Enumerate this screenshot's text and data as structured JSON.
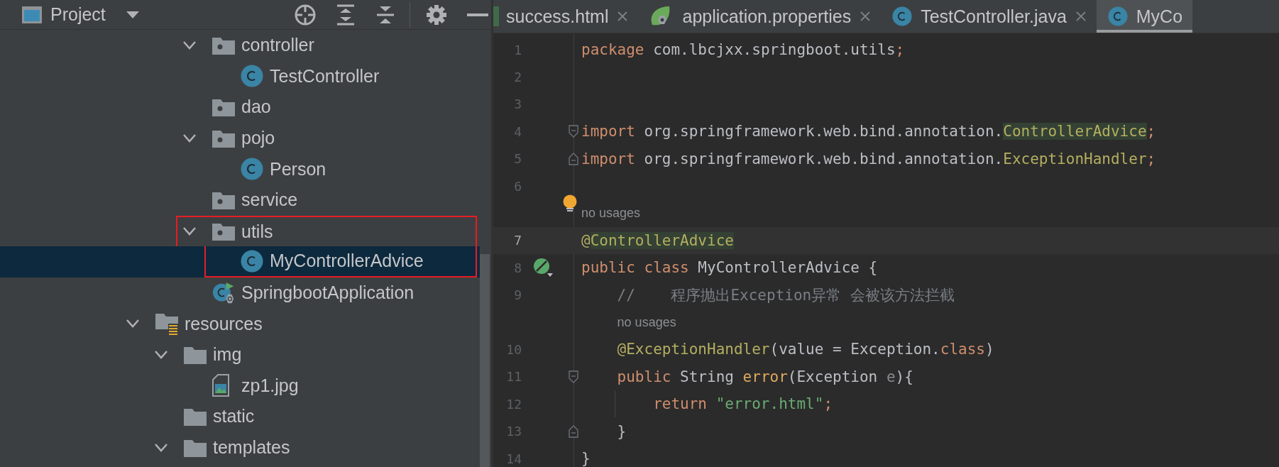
{
  "project_panel": {
    "title": "Project",
    "tree": [
      {
        "children": [
          {
            "children": [
              {
                "label": "controller",
                "kind": "package",
                "expanded": true,
                "selected": false,
                "annotated": false,
                "children": [
                  {
                    "label": "TestController",
                    "kind": "class",
                    "selected": false,
                    "annotated": false
                  }
                ]
              },
              {
                "label": "dao",
                "kind": "package",
                "selected": false,
                "annotated": false
              },
              {
                "label": "pojo",
                "kind": "package",
                "expanded": true,
                "selected": false,
                "annotated": false,
                "children": [
                  {
                    "label": "Person",
                    "kind": "class",
                    "selected": false,
                    "annotated": false
                  }
                ]
              },
              {
                "label": "service",
                "kind": "package",
                "selected": false,
                "annotated": false
              },
              {
                "label": "utils",
                "kind": "package",
                "expanded": true,
                "selected": false,
                "annotated": true,
                "children": [
                  {
                    "label": "MyControllerAdvice",
                    "kind": "class",
                    "selected": true,
                    "annotated": true
                  }
                ]
              },
              {
                "label": "SpringbootApplication",
                "kind": "spring_app",
                "selected": false,
                "annotated": false
              }
            ]
          }
        ]
      },
      {
        "label": "resources",
        "kind": "resources",
        "expanded": true,
        "selected": false,
        "annotated": false,
        "children": [
          {
            "label": "img",
            "kind": "folder",
            "expanded": true,
            "selected": false,
            "annotated": false,
            "children": [
              {
                "label": "zp1.jpg",
                "kind": "image_file",
                "selected": false,
                "annotated": false
              }
            ]
          },
          {
            "label": "static",
            "kind": "folder",
            "selected": false,
            "annotated": false
          },
          {
            "label": "templates",
            "kind": "folder",
            "expanded": true,
            "selected": false,
            "annotated": false
          }
        ]
      }
    ]
  },
  "editor": {
    "tabs": [
      {
        "label": "success.html",
        "kind": "partial",
        "closable": true,
        "selected": false
      },
      {
        "label": "application.properties",
        "kind": "spring",
        "closable": true,
        "selected": false
      },
      {
        "label": "TestController.java",
        "kind": "class",
        "closable": true,
        "selected": false
      },
      {
        "label": "MyCo",
        "kind": "class",
        "closable": false,
        "selected": true
      }
    ],
    "lines": [
      {
        "kind": "code",
        "number": "1",
        "current": false,
        "tokens": [
          {
            "text": "package",
            "kind": "keyword"
          },
          {
            "text": " com.lbcjxx.springboot.utils",
            "kind": "text"
          },
          {
            "text": ";",
            "kind": "keyword"
          }
        ]
      },
      {
        "kind": "code",
        "number": "2",
        "current": false
      },
      {
        "kind": "code",
        "number": "3",
        "current": false
      },
      {
        "kind": "code",
        "number": "4",
        "current": false,
        "marker": {
          "kind": "fold_start"
        },
        "tokens": [
          {
            "text": "import",
            "kind": "keyword"
          },
          {
            "text": " org.springframework.web.bind.annotation.",
            "kind": "text"
          },
          {
            "text": "ControllerAdvice",
            "kind": "annotation",
            "usage_highlight": true
          },
          {
            "text": ";",
            "kind": "keyword"
          }
        ]
      },
      {
        "kind": "code",
        "number": "5",
        "current": false,
        "marker": {
          "kind": "fold_end"
        },
        "tokens": [
          {
            "text": "import",
            "kind": "keyword"
          },
          {
            "text": " org.springframework.web.bind.annotation.",
            "kind": "text"
          },
          {
            "text": "ExceptionHandler",
            "kind": "annotation"
          },
          {
            "text": ";",
            "kind": "keyword"
          }
        ]
      },
      {
        "kind": "code",
        "number": "6",
        "current": false
      },
      {
        "kind": "inlay",
        "text": "no usages",
        "bulb": true
      },
      {
        "kind": "code",
        "number": "7",
        "current": true,
        "tokens": [
          {
            "text": "@",
            "kind": "annotation"
          },
          {
            "text": "ControllerAdvice",
            "kind": "annotation",
            "usage_highlight": true
          }
        ]
      },
      {
        "kind": "code",
        "number": "8",
        "current": false,
        "marker": {
          "kind": "bean"
        },
        "tokens": [
          {
            "text": "public",
            "kind": "keyword"
          },
          {
            "text": " class",
            "kind": "keyword"
          },
          {
            "text": " MyControllerAdvice {",
            "kind": "text"
          }
        ]
      },
      {
        "kind": "code",
        "number": "9",
        "current": false,
        "tokens": [
          {
            "text": "    //    程序抛出Exception异常 会被该方法拦截",
            "kind": "comment"
          }
        ]
      },
      {
        "kind": "inlay",
        "text": "no usages",
        "bulb": false
      },
      {
        "kind": "code",
        "number": "10",
        "current": false,
        "tokens": [
          {
            "text": "    @ExceptionHandler",
            "kind": "annotation"
          },
          {
            "text": "(value = Exception.",
            "kind": "text"
          },
          {
            "text": "class",
            "kind": "keyword"
          },
          {
            "text": ")",
            "kind": "text"
          }
        ]
      },
      {
        "kind": "code",
        "number": "11",
        "current": false,
        "marker": {
          "kind": "fold_start"
        },
        "tokens": [
          {
            "text": "    public",
            "kind": "keyword"
          },
          {
            "text": " String ",
            "kind": "text"
          },
          {
            "text": "error",
            "kind": "method"
          },
          {
            "text": "(Exception ",
            "kind": "text"
          },
          {
            "text": "e",
            "kind": "param"
          },
          {
            "text": "){",
            "kind": "text"
          }
        ]
      },
      {
        "kind": "code",
        "number": "12",
        "current": false,
        "indent_guide": true,
        "tokens": [
          {
            "text": "        return",
            "kind": "keyword"
          },
          {
            "text": " \"error.html\"",
            "kind": "string"
          },
          {
            "text": ";",
            "kind": "keyword"
          }
        ]
      },
      {
        "kind": "code",
        "number": "13",
        "current": false,
        "marker": {
          "kind": "fold_end"
        },
        "tokens": [
          {
            "text": "    }",
            "kind": "text"
          }
        ]
      },
      {
        "kind": "code",
        "number": "14",
        "current": false,
        "tokens": [
          {
            "text": "}",
            "kind": "text"
          }
        ]
      }
    ]
  }
}
